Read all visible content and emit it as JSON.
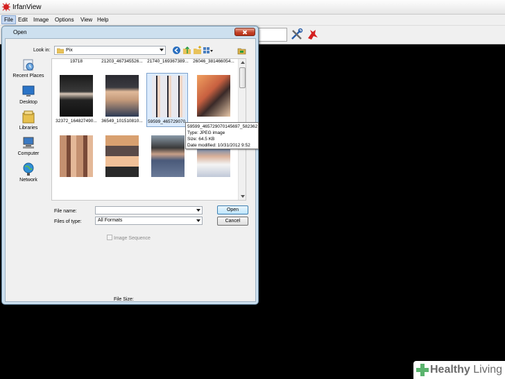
{
  "app": {
    "title": "IrfanView"
  },
  "menubar": {
    "items": [
      "File",
      "Edit",
      "Image",
      "Options",
      "View",
      "Help"
    ]
  },
  "dialog": {
    "title": "Open",
    "look_in_label": "Look in:",
    "look_in_value": "Pix",
    "places": [
      {
        "label": "Recent Places",
        "icon": "recent-places-icon"
      },
      {
        "label": "Desktop",
        "icon": "desktop-icon"
      },
      {
        "label": "Libraries",
        "icon": "libraries-icon"
      },
      {
        "label": "Computer",
        "icon": "computer-icon"
      },
      {
        "label": "Network",
        "icon": "network-icon"
      }
    ],
    "files": [
      "19718",
      "21203_467345526...",
      "21740_169367389...",
      "26046_381466054...",
      "32372_164827490...",
      "36549_101510810...",
      "59599_465729070...",
      "",
      "",
      "",
      "",
      ""
    ],
    "tooltip": {
      "name": "59599_465729070145697_582362",
      "type": "Type: JPEG image",
      "size": "Size: 64.5 KB",
      "modified": "Date modified: 10/31/2012 9:52"
    },
    "file_name_label": "File name:",
    "file_name_value": "",
    "files_of_type_label": "Files of type:",
    "files_of_type_value": "All Formats",
    "open_label": "Open",
    "cancel_label": "Cancel",
    "image_sequence_label": "Image Sequence",
    "file_size_label": "File Size:"
  },
  "watermark": {
    "text_bold": "Healthy",
    "text_light": " Living"
  },
  "colors": {
    "accent": "#3c7fb1",
    "close": "#c3432a",
    "brand": "#5bb46e"
  }
}
